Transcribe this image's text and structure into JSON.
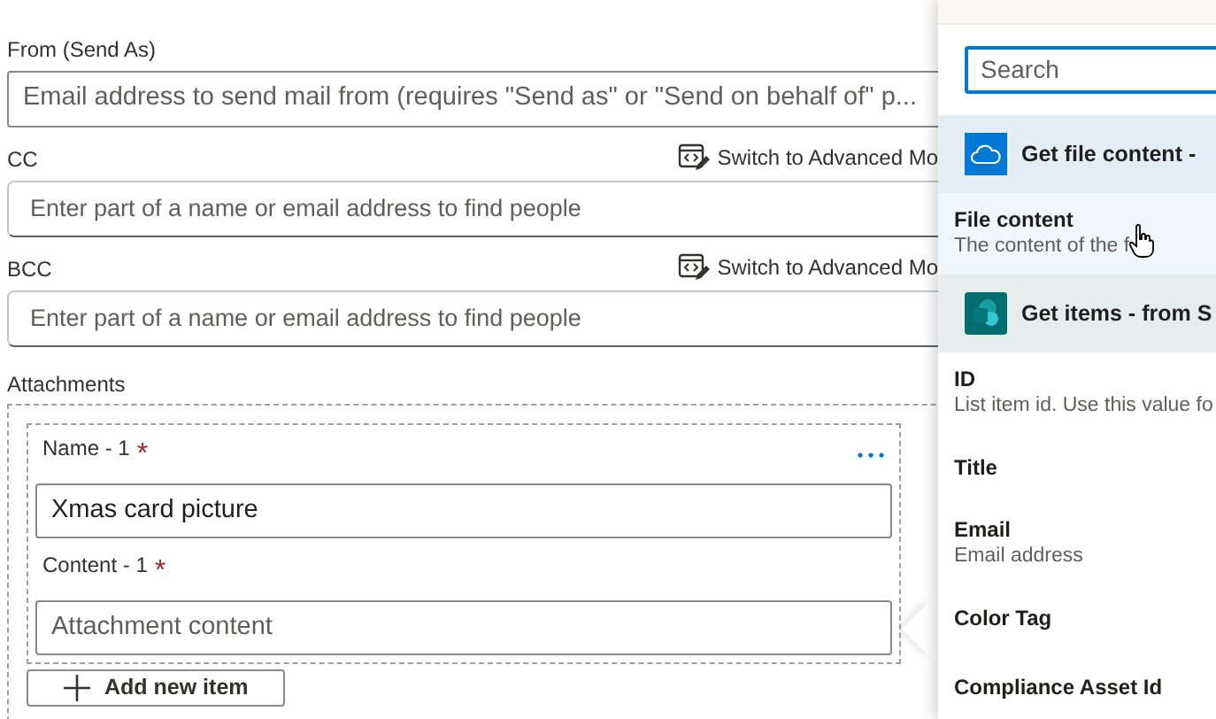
{
  "form": {
    "fields": [
      {
        "label": "From (Send As)",
        "kind": "text",
        "placeholder": "Email address to send mail from (requires \"Send as\" or \"Send on behalf of\" p..."
      },
      {
        "label": "CC",
        "kind": "people",
        "placeholder": "Enter part of a name or email address to find people",
        "switch_link": "Switch to Advanced Mo"
      },
      {
        "label": "BCC",
        "kind": "people",
        "placeholder": "Enter part of a name or email address to find people",
        "switch_link": "Switch to Advanced Mo"
      }
    ],
    "attachments": {
      "label": "Attachments",
      "items": [
        {
          "name_label": "Name - 1",
          "name_required": "*",
          "name_value": "Xmas card picture",
          "content_label": "Content - 1",
          "content_required": "*",
          "content_placeholder": "Attachment content"
        }
      ],
      "add_button": "Add new item"
    }
  },
  "panel": {
    "search": {
      "placeholder": "Search"
    },
    "groups": [
      {
        "title": "Get file content -",
        "kind": "onedrive",
        "items": [
          {
            "name": "File content",
            "description": "The content of the f",
            "hovered": true
          }
        ]
      },
      {
        "title": "Get items - from S",
        "kind": "sharepoint",
        "items": [
          {
            "name": "ID",
            "description": "List item id. Use this value fo",
            "hovered": false
          },
          {
            "name": "Title",
            "hovered": false
          },
          {
            "name": "Email",
            "description": "Email address",
            "hovered": false
          },
          {
            "name": "Color Tag",
            "hovered": false
          },
          {
            "name": "Compliance Asset Id",
            "hovered": false
          }
        ]
      }
    ]
  }
}
